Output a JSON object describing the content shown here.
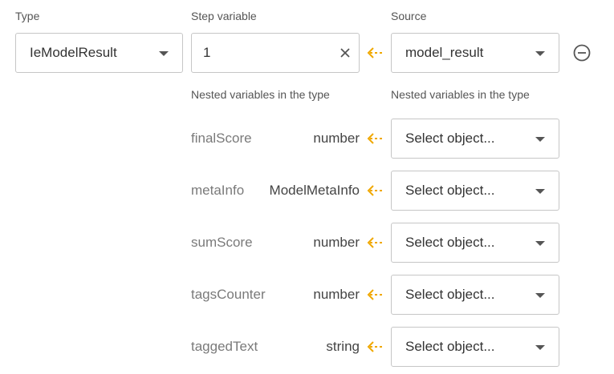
{
  "headers": {
    "type": "Type",
    "step_variable": "Step variable",
    "source": "Source",
    "nested_left": "Nested variables in the type",
    "nested_right": "Nested variables in the type"
  },
  "type_select": {
    "value": "IeModelResult"
  },
  "step_variable": {
    "value": "1"
  },
  "source_select": {
    "value": "model_result"
  },
  "icons": {
    "arrow": "arrow-left-dashed-icon",
    "clear": "close-icon",
    "remove": "minus-circle-icon",
    "caret": "chevron-down-icon"
  },
  "colors": {
    "accent": "#f0a800",
    "border": "#c6c6c6"
  },
  "nested": [
    {
      "name": "finalScore",
      "type": "number",
      "select": "Select object..."
    },
    {
      "name": "metaInfo",
      "type": "ModelMetaInfo",
      "select": "Select object..."
    },
    {
      "name": "sumScore",
      "type": "number",
      "select": "Select object..."
    },
    {
      "name": "tagsCounter",
      "type": "number",
      "select": "Select object..."
    },
    {
      "name": "taggedText",
      "type": "string",
      "select": "Select object..."
    }
  ]
}
